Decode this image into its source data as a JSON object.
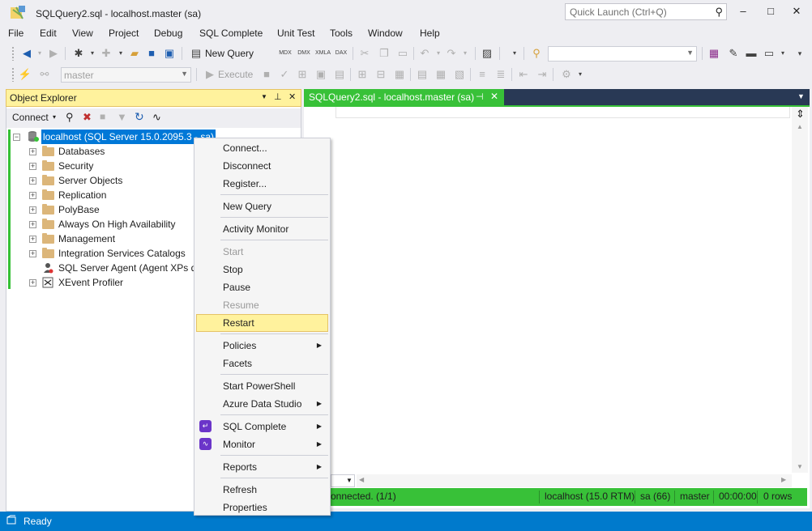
{
  "window": {
    "title": "SQLQuery2.sql - localhost.master (sa)",
    "quick_launch_placeholder": "Quick Launch (Ctrl+Q)",
    "minimize": "–",
    "maximize": "□",
    "close": "✕"
  },
  "menu": [
    "File",
    "Edit",
    "View",
    "Project",
    "Debug",
    "SQL Complete",
    "Unit Test",
    "Tools",
    "Window",
    "Help"
  ],
  "toolbar1": {
    "new_query_label": "New Query",
    "db_icons": [
      "MDX",
      "DMX",
      "XMLA",
      "DAX"
    ]
  },
  "toolbar2": {
    "database_combo": "master",
    "execute_label": "Execute"
  },
  "object_explorer": {
    "title": "Object Explorer",
    "connect_label": "Connect",
    "server_node": "localhost (SQL Server 15.0.2095.3 - sa)",
    "nodes": [
      "Databases",
      "Security",
      "Server Objects",
      "Replication",
      "PolyBase",
      "Always On High Availability",
      "Management",
      "Integration Services Catalogs",
      "SQL Server Agent (Agent XPs dis",
      "XEvent Profiler"
    ]
  },
  "document": {
    "tab_label": "SQLQuery2.sql - localhost.master (sa)",
    "status": {
      "connected": "onnected. (1/1)",
      "server": "localhost (15.0 RTM)",
      "user": "sa (66)",
      "database": "master",
      "time": "00:00:00",
      "rows": "0 rows"
    }
  },
  "context_menu": {
    "items": [
      {
        "label": "Connect...",
        "enabled": true
      },
      {
        "label": "Disconnect",
        "enabled": true
      },
      {
        "label": "Register...",
        "enabled": true
      },
      {
        "label": "New Query",
        "enabled": true
      },
      {
        "label": "Activity Monitor",
        "enabled": true
      },
      {
        "label": "Start",
        "enabled": false
      },
      {
        "label": "Stop",
        "enabled": true
      },
      {
        "label": "Pause",
        "enabled": true
      },
      {
        "label": "Resume",
        "enabled": false
      },
      {
        "label": "Restart",
        "enabled": true,
        "highlighted": true
      },
      {
        "label": "Policies",
        "enabled": true,
        "submenu": true
      },
      {
        "label": "Facets",
        "enabled": true
      },
      {
        "label": "Start PowerShell",
        "enabled": true
      },
      {
        "label": "Azure Data Studio",
        "enabled": true,
        "submenu": true
      },
      {
        "label": "SQL Complete",
        "enabled": true,
        "submenu": true,
        "icon": "sql-complete-icon"
      },
      {
        "label": "Monitor",
        "enabled": true,
        "submenu": true,
        "icon": "monitor-icon"
      },
      {
        "label": "Reports",
        "enabled": true,
        "submenu": true
      },
      {
        "label": "Refresh",
        "enabled": true
      },
      {
        "label": "Properties",
        "enabled": true
      }
    ]
  },
  "statusbar": {
    "text": "Ready"
  },
  "colors": {
    "accent_green": "#38c138",
    "status_blue": "#007acc",
    "highlight_yellow": "#fff29d"
  }
}
